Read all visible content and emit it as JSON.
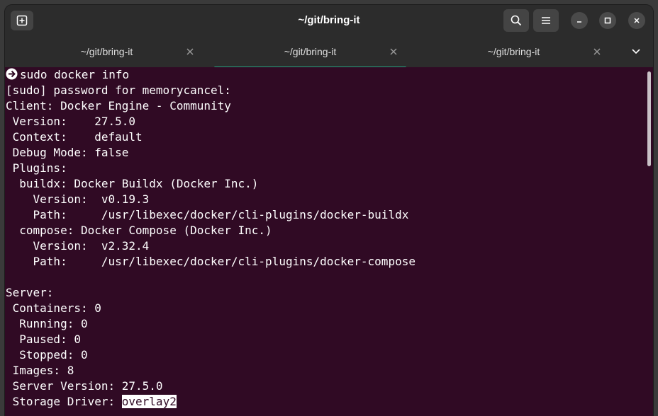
{
  "window": {
    "title": "~/git/bring-it"
  },
  "header": {
    "new_tab_icon": "new-tab-icon",
    "search_icon": "search-icon",
    "menu_icon": "hamburger-menu-icon",
    "minimize_icon": "minimize-icon",
    "maximize_icon": "maximize-icon",
    "close_icon": "close-icon"
  },
  "tabs": [
    {
      "label": "~/git/bring-it",
      "active": false
    },
    {
      "label": "~/git/bring-it",
      "active": true
    },
    {
      "label": "~/git/bring-it",
      "active": false
    }
  ],
  "colors": {
    "terminal_bg": "#300a24",
    "accent": "#26a07f",
    "text": "#ffffff"
  },
  "terminal": {
    "prompt_command": "sudo docker info",
    "lines": [
      "[sudo] password for memorycancel:",
      "Client: Docker Engine - Community",
      " Version:    27.5.0",
      " Context:    default",
      " Debug Mode: false",
      " Plugins:",
      "  buildx: Docker Buildx (Docker Inc.)",
      "    Version:  v0.19.3",
      "    Path:     /usr/libexec/docker/cli-plugins/docker-buildx",
      "  compose: Docker Compose (Docker Inc.)",
      "    Version:  v2.32.4",
      "    Path:     /usr/libexec/docker/cli-plugins/docker-compose",
      "",
      "Server:",
      " Containers: 0",
      "  Running: 0",
      "  Paused: 0",
      "  Stopped: 0",
      " Images: 8",
      " Server Version: 27.5.0"
    ],
    "last_line_prefix": " Storage Driver: ",
    "last_line_selected": "overlay2"
  }
}
